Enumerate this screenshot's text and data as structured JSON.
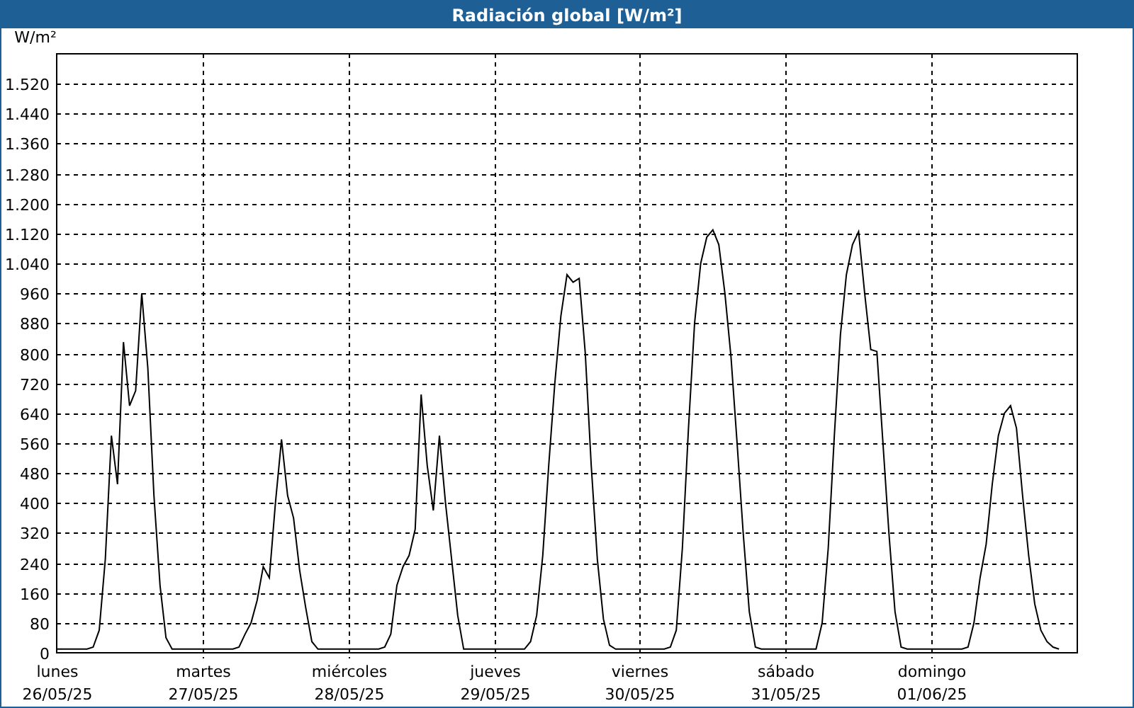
{
  "window": {
    "title": "Radiación global [W/m²]"
  },
  "chart_data": {
    "type": "line",
    "ylabel": "W/m²",
    "grid": true,
    "ylim": [
      0,
      1600
    ],
    "yticks": [
      {
        "value": 0,
        "label": "0"
      },
      {
        "value": 80,
        "label": "80"
      },
      {
        "value": 160,
        "label": "160"
      },
      {
        "value": 240,
        "label": "240"
      },
      {
        "value": 320,
        "label": "320"
      },
      {
        "value": 400,
        "label": "400"
      },
      {
        "value": 480,
        "label": "480"
      },
      {
        "value": 560,
        "label": "560"
      },
      {
        "value": 640,
        "label": "640"
      },
      {
        "value": 720,
        "label": "720"
      },
      {
        "value": 800,
        "label": "800"
      },
      {
        "value": 880,
        "label": "880"
      },
      {
        "value": 960,
        "label": "960"
      },
      {
        "value": 1040,
        "label": "1.040"
      },
      {
        "value": 1120,
        "label": "1.120"
      },
      {
        "value": 1200,
        "label": "1.200"
      },
      {
        "value": 1280,
        "label": "1.280"
      },
      {
        "value": 1360,
        "label": "1.360"
      },
      {
        "value": 1440,
        "label": "1.440"
      },
      {
        "value": 1520,
        "label": "1.520"
      }
    ],
    "categories": [
      "lunes\n26/05/25",
      null,
      null,
      null,
      null,
      null,
      null,
      null,
      null,
      null,
      null,
      null,
      null,
      null,
      null,
      null,
      null,
      null,
      null,
      null,
      null,
      null,
      null,
      null,
      "martes\n27/05/25",
      null,
      null,
      null,
      null,
      null,
      null,
      null,
      null,
      null,
      null,
      null,
      null,
      null,
      null,
      null,
      null,
      null,
      null,
      null,
      null,
      null,
      null,
      null,
      "miércoles\n28/05/25",
      null,
      null,
      null,
      null,
      null,
      null,
      null,
      null,
      null,
      null,
      null,
      null,
      null,
      null,
      null,
      null,
      null,
      null,
      null,
      null,
      null,
      null,
      null,
      "jueves\n29/05/25",
      null,
      null,
      null,
      null,
      null,
      null,
      null,
      null,
      null,
      null,
      null,
      null,
      null,
      null,
      null,
      null,
      null,
      null,
      null,
      null,
      null,
      null,
      null,
      "viernes\n30/05/25",
      null,
      null,
      null,
      null,
      null,
      null,
      null,
      null,
      null,
      null,
      null,
      null,
      null,
      null,
      null,
      null,
      null,
      null,
      null,
      null,
      null,
      null,
      null,
      "sábado\n31/05/25",
      null,
      null,
      null,
      null,
      null,
      null,
      null,
      null,
      null,
      null,
      null,
      null,
      null,
      null,
      null,
      null,
      null,
      null,
      null,
      null,
      null,
      null,
      null,
      "domingo\n01/06/25",
      null,
      null,
      null,
      null,
      null,
      null,
      null,
      null,
      null,
      null,
      null,
      null,
      null,
      null,
      null,
      null,
      null,
      null,
      null,
      null,
      null
    ],
    "series": [
      {
        "color": "#000000",
        "values": [
          10,
          10,
          10,
          10,
          10,
          10,
          15,
          60,
          250,
          580,
          450,
          830,
          660,
          700,
          960,
          760,
          420,
          180,
          40,
          10,
          10,
          10,
          10,
          10,
          10,
          10,
          10,
          10,
          10,
          10,
          15,
          50,
          80,
          140,
          230,
          200,
          400,
          570,
          420,
          360,
          220,
          120,
          30,
          10,
          10,
          10,
          10,
          10,
          10,
          10,
          10,
          10,
          10,
          10,
          15,
          50,
          180,
          230,
          260,
          330,
          690,
          500,
          380,
          580,
          400,
          250,
          100,
          10,
          10,
          10,
          10,
          10,
          10,
          10,
          10,
          10,
          10,
          10,
          30,
          100,
          260,
          500,
          720,
          900,
          1010,
          990,
          1000,
          800,
          500,
          250,
          90,
          20,
          10,
          10,
          10,
          10,
          10,
          10,
          10,
          10,
          10,
          15,
          60,
          280,
          600,
          880,
          1040,
          1110,
          1130,
          1090,
          960,
          790,
          560,
          320,
          110,
          15,
          10,
          10,
          10,
          10,
          10,
          10,
          10,
          10,
          10,
          10,
          80,
          280,
          580,
          850,
          1010,
          1090,
          1125,
          960,
          810,
          805,
          560,
          320,
          110,
          15,
          10,
          10,
          10,
          10,
          10,
          10,
          10,
          10,
          10,
          10,
          15,
          80,
          200,
          290,
          450,
          580,
          640,
          660,
          600,
          420,
          260,
          130,
          60,
          30,
          15,
          10
        ]
      }
    ]
  }
}
